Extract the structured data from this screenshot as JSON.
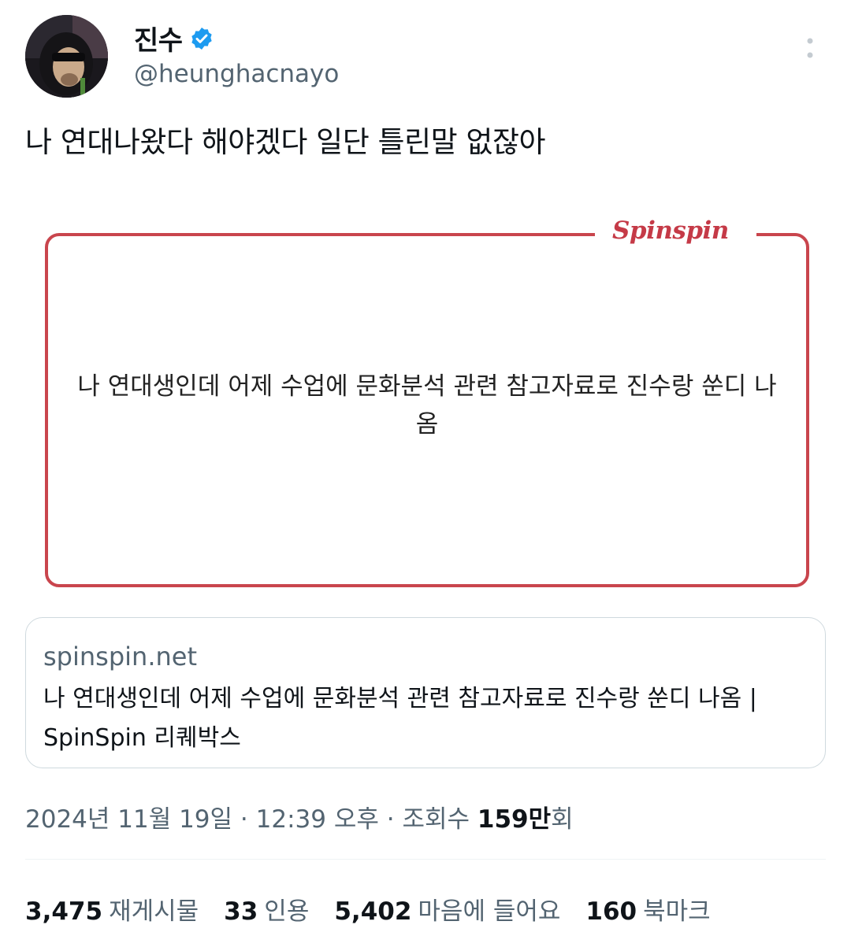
{
  "author": {
    "display_name": "진수",
    "handle": "@heunghacnayo",
    "verified_icon": "verified-badge-icon",
    "avatar_icon": "avatar-image"
  },
  "more_icon": "more-vertical-icon",
  "tweet": {
    "text": "나 연대나왔다 해야겠다 일단 틀린말 없잖아"
  },
  "media": {
    "brand": "Spinspin",
    "quote": "나 연대생인데 어제 수업에 문화분석 관련 참고자료로 진수랑 쑨디 나옴",
    "frame_color": "#c9454d"
  },
  "link_card": {
    "domain": "spinspin.net",
    "title": "나 연대생인데 어제 수업에 문화분석 관련 참고자료로 진수랑 쑨디 나옴 | SpinSpin 리퀘박스"
  },
  "meta": {
    "date": "2024년 11월 19일",
    "time": "12:39 오후",
    "views_label": "조회수",
    "views_value": "159만",
    "views_suffix": "회"
  },
  "stats": {
    "reposts_count": "3,475",
    "reposts_label": "재게시물",
    "quotes_count": "33",
    "quotes_label": "인용",
    "likes_count": "5,402",
    "likes_label": "마음에 들어요",
    "bookmarks_count": "160",
    "bookmarks_label": "북마크"
  },
  "colors": {
    "verified": "#1d9bf0",
    "secondary_text": "#536471",
    "brand": "#c53a47"
  }
}
